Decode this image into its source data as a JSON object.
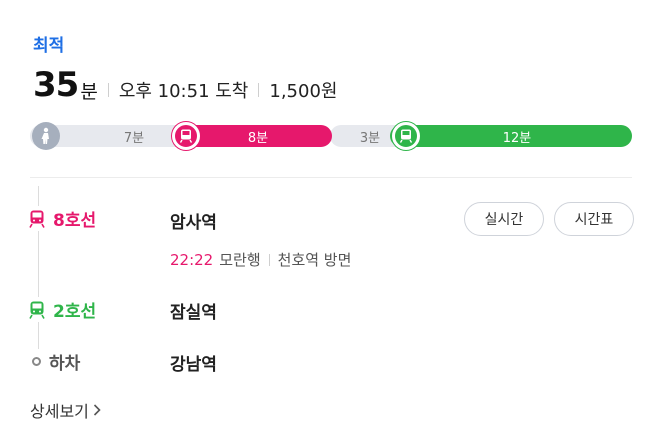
{
  "header": {
    "best_label": "최적",
    "duration_num": "35",
    "duration_unit": "분",
    "arrival": "오후 10:51 도착",
    "fare": "1,500원"
  },
  "timeline": {
    "walk": "7분",
    "line8": "8분",
    "transfer": "3분",
    "line2": "12분"
  },
  "colors": {
    "line8": "#e6186c",
    "line2": "#2fb54a",
    "accent": "#1f6fe5"
  },
  "steps": [
    {
      "line": "8호선",
      "station": "암사역",
      "icon": "subway-icon"
    },
    {
      "line": "2호선",
      "station": "잠실역",
      "icon": "subway-icon"
    },
    {
      "line": "하차",
      "station": "강남역",
      "icon": "circle-icon"
    }
  ],
  "first_detail": {
    "time": "22:22",
    "direction1": "모란행",
    "direction2": "천호역 방면"
  },
  "buttons": {
    "realtime": "실시간",
    "timetable": "시간표"
  },
  "more": {
    "label": "상세보기"
  }
}
